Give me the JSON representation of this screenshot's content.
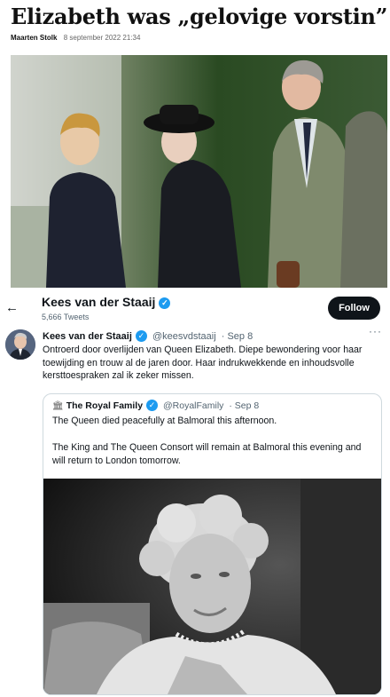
{
  "article": {
    "title": "Elizabeth was „gelovige vorstin”",
    "author": "Maarten Stolk",
    "date": "8 september 2022 21:34"
  },
  "profile": {
    "back_icon": "←",
    "name": "Kees van der Staaij",
    "tweet_count": "5,666 Tweets",
    "follow_label": "Follow"
  },
  "tweet": {
    "name": "Kees van der Staaij",
    "handle": "@keesvdstaaij",
    "date": "· Sep 8",
    "more": "···",
    "text": "Ontroerd door overlijden van Queen Elizabeth. Diepe bewondering voor haar toewijding en trouw al de jaren door. Haar indrukwekkende en inhoudsvolle kersttoespraken zal ik zeker missen."
  },
  "quote": {
    "name": "The Royal Family",
    "handle": "@RoyalFamily",
    "date": "· Sep 8",
    "line1": "The Queen died peacefully at Balmoral this afternoon.",
    "line2": "The King and The Queen Consort will remain at Balmoral this evening and will return to London tomorrow."
  },
  "colors": {
    "accent": "#1d9bf0",
    "button": "#0f1419",
    "muted": "#536471"
  }
}
